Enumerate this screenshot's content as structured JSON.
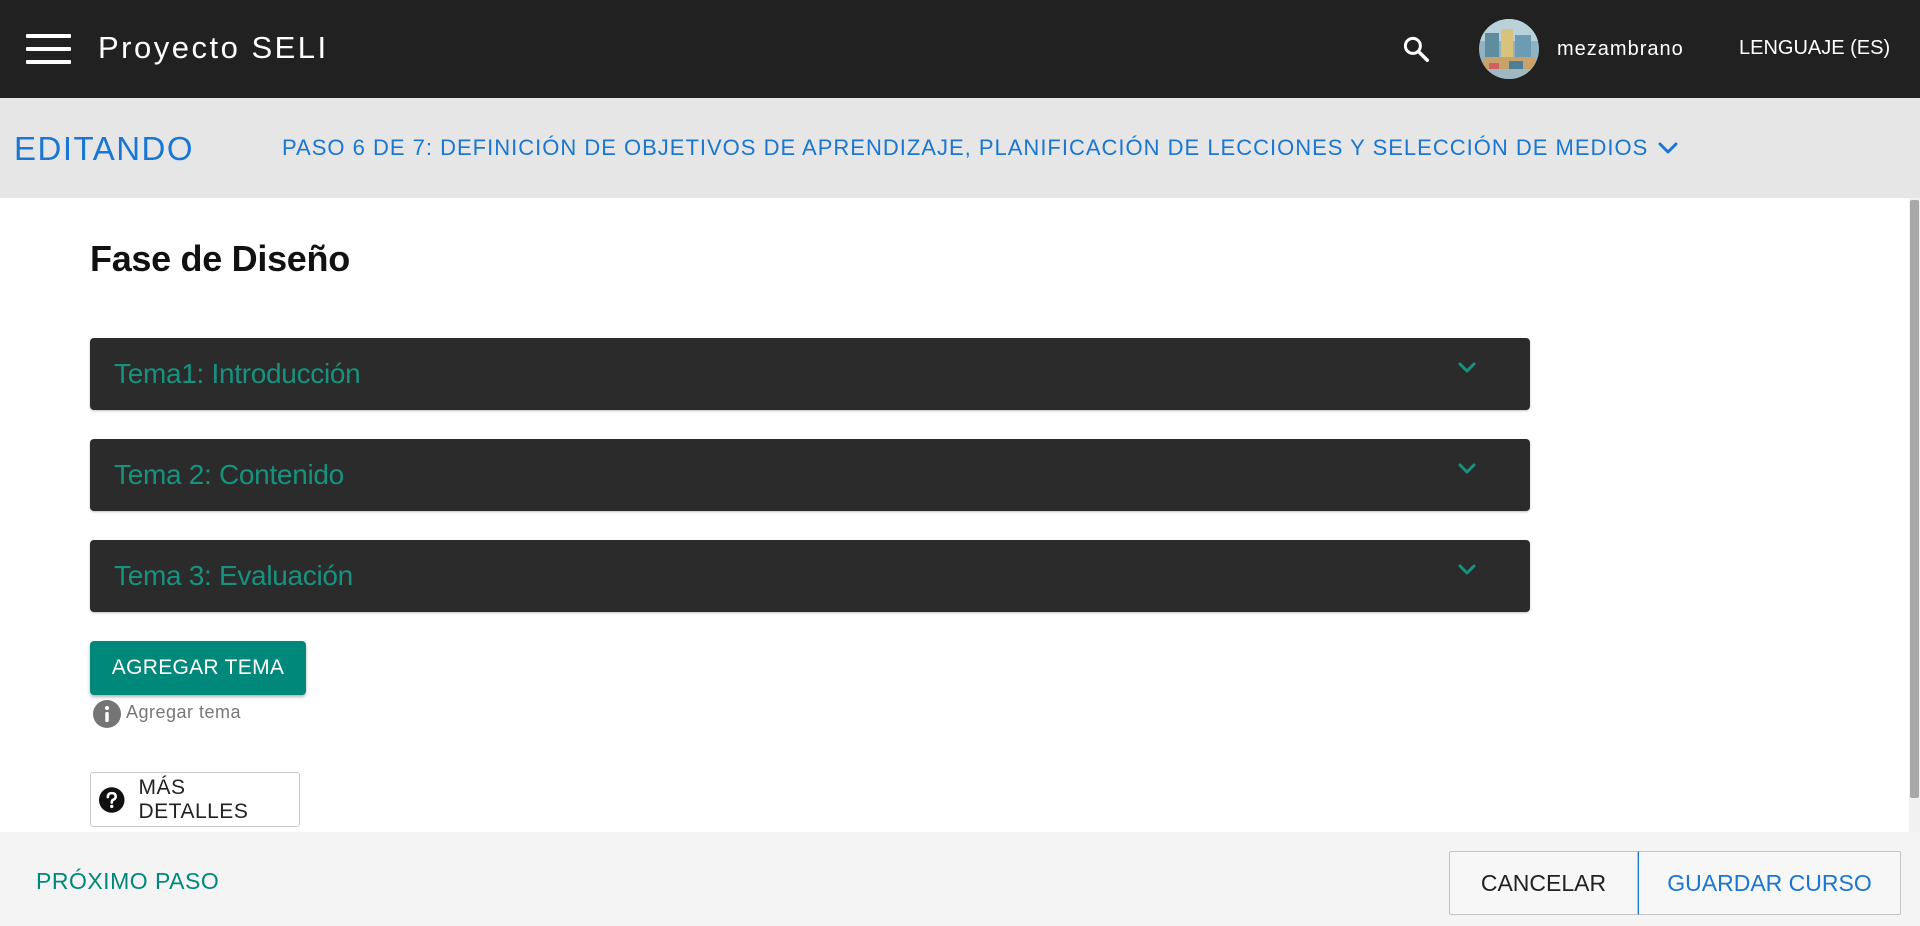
{
  "appbar": {
    "title": "Proyecto SELI",
    "username": "mezambrano",
    "language": "LENGUAJE (ES)",
    "icons": {
      "menu": "hamburger-menu-icon",
      "search": "search-icon"
    }
  },
  "stepbar": {
    "mode_label": "EDITANDO",
    "current_step": "PASO 6 DE 7: DEFINICIÓN DE OBJETIVOS DE APRENDIZAJE, PLANIFICACIÓN DE LECCIONES Y SELECCIÓN DE MEDIOS"
  },
  "main": {
    "page_title": "Fase de Diseño",
    "topics": [
      {
        "title": "Tema1: Introducción"
      },
      {
        "title": "Tema 2: Contenido"
      },
      {
        "title": "Tema 3: Evaluación"
      }
    ],
    "add_topic_label": "AGREGAR TEMA",
    "add_topic_helper": "Agregar tema",
    "more_details_label": "MÁS DETALLES"
  },
  "footer": {
    "next_step_label": "PRÓXIMO PASO",
    "cancel_label": "CANCELAR",
    "save_label": "GUARDAR CURSO"
  },
  "colors": {
    "appbar_bg": "#212121",
    "accent_blue": "#1976d2",
    "accent_teal": "#00897b",
    "topic_bg": "#2b2b2b",
    "stepbar_bg": "#e6e6e7"
  }
}
